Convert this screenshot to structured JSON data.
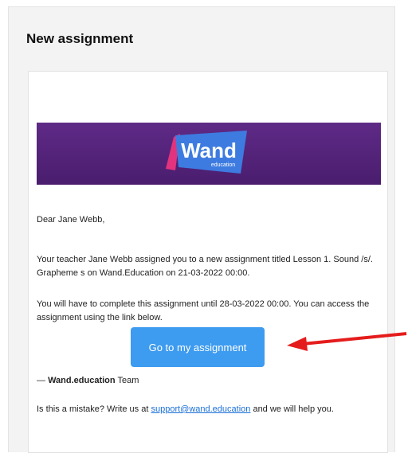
{
  "email": {
    "heading": "New assignment",
    "banner": {
      "brand_text": "Wand",
      "brand_sub": "education",
      "accent_colors": [
        "#5e2a86",
        "#e2337e",
        "#3d7be0"
      ]
    },
    "greeting": "Dear Jane Webb,",
    "para1": "Your teacher Jane Webb assigned you to a new assignment titled Lesson 1. Sound /s/. Grapheme s on Wand.Education on 21-03-2022 00:00.",
    "para2": "You will have to complete this assignment until 28-03-2022 00:00. You can access the assignment using the link below.",
    "cta_label": "Go to my assignment",
    "signature_dash": "— ",
    "signature_brand": "Wand.education",
    "signature_rest": " Team",
    "mistake_prefix": "Is this a mistake? Write us at ",
    "support_email": "support@wand.education",
    "mistake_suffix": " and we will help you."
  },
  "annotation": {
    "arrow_icon": "red-arrow-icon",
    "color": "#e51c1c"
  }
}
